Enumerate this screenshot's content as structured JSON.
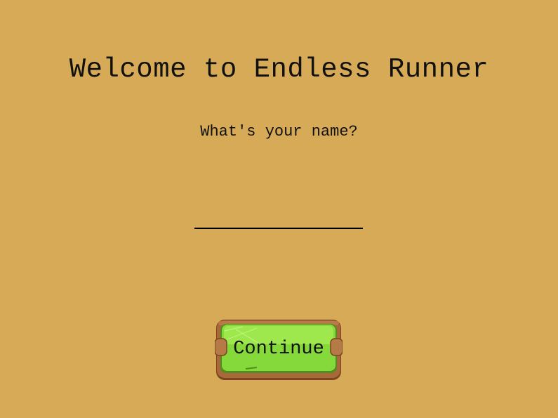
{
  "screen": {
    "title": "Welcome to Endless Runner",
    "prompt": "What's your name?"
  },
  "name_input": {
    "value": "",
    "placeholder": ""
  },
  "continue_button": {
    "label": "Continue"
  },
  "colors": {
    "background": "#d6aa56",
    "button_frame": "#9e6232",
    "button_face": "#84d83a",
    "text": "#111111"
  }
}
